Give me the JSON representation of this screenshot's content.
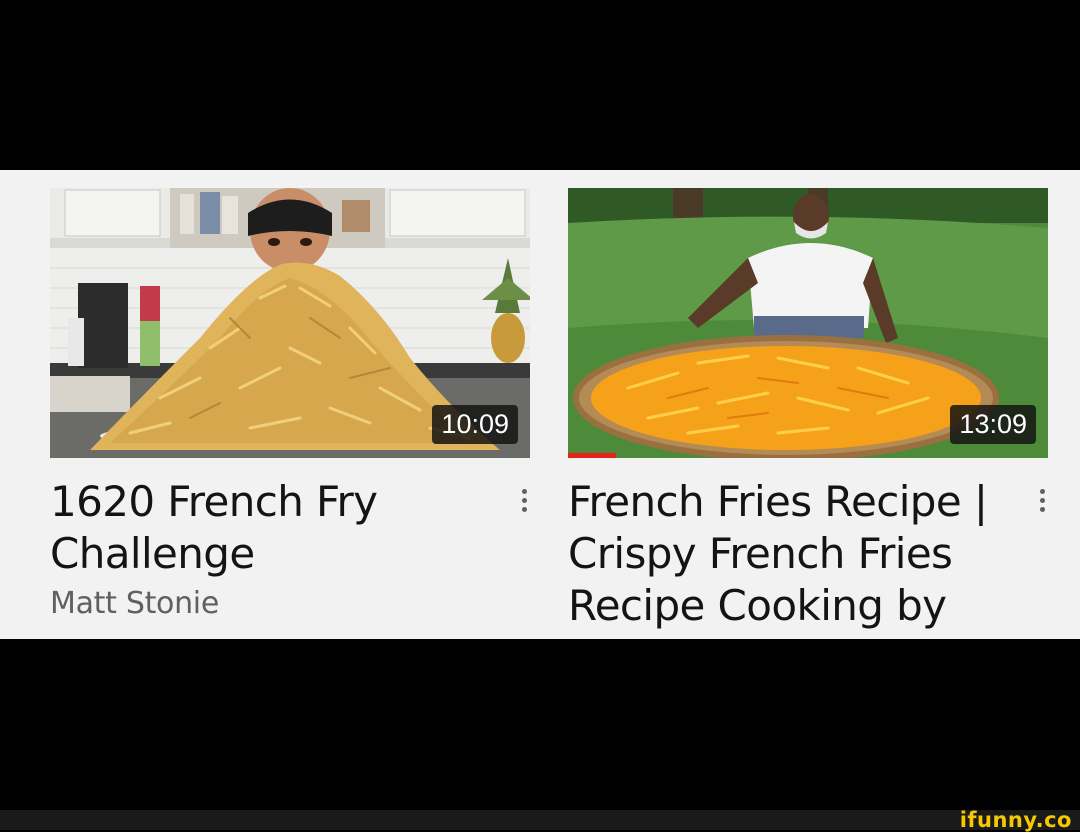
{
  "videos": [
    {
      "duration": "10:09",
      "title": "1620 French Fry Challenge",
      "channel": "Matt Stonie"
    },
    {
      "duration": "13:09",
      "title": "French Fries Recipe | Crispy French Fries Recipe Cooking by o...",
      "channel": ""
    }
  ],
  "watermark": "ifunny.co",
  "colors": {
    "progress": "#e62117",
    "panel_bg": "#f2f2f2",
    "title_text": "#141414",
    "channel_text": "#606060",
    "watermark": "#f5c800"
  },
  "icons": {
    "more_menu": "more-vert-icon"
  }
}
